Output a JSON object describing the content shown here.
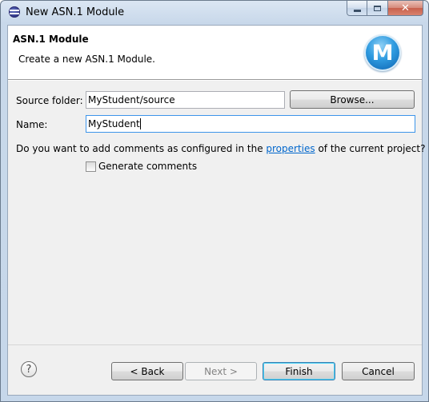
{
  "window": {
    "title": "New ASN.1 Module",
    "minimize_icon": "minimize-icon",
    "maximize_icon": "maximize-icon",
    "close_label": "✕"
  },
  "banner": {
    "title": "ASN.1 Module",
    "message": "Create a new ASN.1 Module.",
    "logo_letter": "M"
  },
  "form": {
    "source_folder_label": "Source folder:",
    "source_folder_value": "MyStudent/source",
    "browse_label": "Browse...",
    "name_label": "Name:",
    "name_value": "MyStudent",
    "comments_prefix": "Do you want to add comments as configured in the ",
    "comments_link": "properties",
    "comments_suffix": " of the current project?",
    "generate_comments_label": "Generate comments",
    "generate_comments_checked": false
  },
  "footer": {
    "help_label": "?",
    "back_label": "< Back",
    "next_label": "Next >",
    "finish_label": "Finish",
    "cancel_label": "Cancel"
  },
  "colors": {
    "link": "#0066cc",
    "focus_border": "#3d95ea",
    "logo": "#2f9be0"
  }
}
